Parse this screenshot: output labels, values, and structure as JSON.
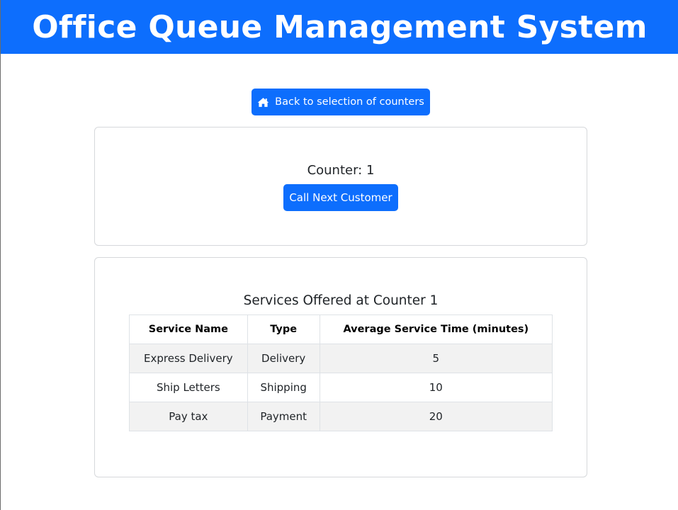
{
  "header": {
    "title": "Office Queue Management System"
  },
  "nav": {
    "back_label": "Back to selection of counters"
  },
  "counter": {
    "title": "Counter: 1",
    "call_next_label": "Call Next Customer"
  },
  "services": {
    "title": "Services Offered at Counter 1",
    "columns": [
      "Service Name",
      "Type",
      "Average Service Time (minutes)"
    ],
    "rows": [
      [
        "Express Delivery",
        "Delivery",
        "5"
      ],
      [
        "Ship Letters",
        "Shipping",
        "10"
      ],
      [
        "Pay tax",
        "Payment",
        "20"
      ]
    ]
  },
  "colors": {
    "primary": "#0d6efd",
    "stripe": "#f2f2f2"
  },
  "icons": {
    "back": "home-icon"
  }
}
